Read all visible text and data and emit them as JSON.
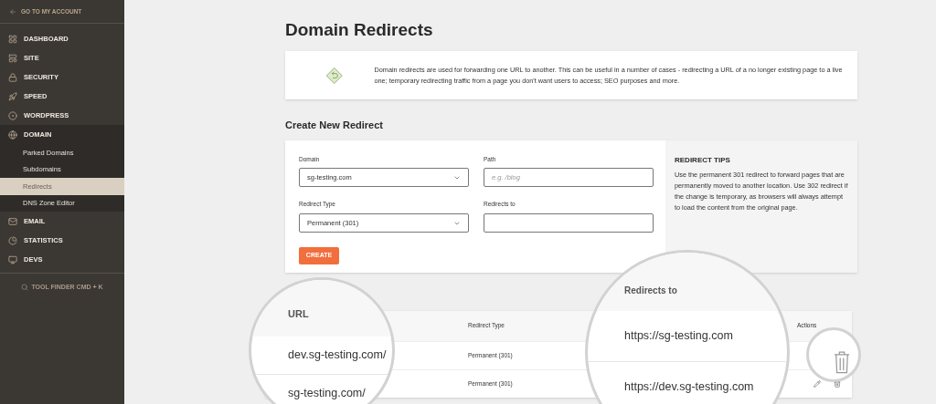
{
  "sidebar": {
    "back_link": "GO TO MY ACCOUNT",
    "items": [
      {
        "label": "DASHBOARD",
        "expanded": false
      },
      {
        "label": "SITE",
        "expanded": false
      },
      {
        "label": "SECURITY",
        "expanded": false
      },
      {
        "label": "SPEED",
        "expanded": false
      },
      {
        "label": "WORDPRESS",
        "expanded": false
      },
      {
        "label": "DOMAIN",
        "expanded": true,
        "children": [
          {
            "label": "Parked Domains",
            "selected": false
          },
          {
            "label": "Subdomains",
            "selected": false
          },
          {
            "label": "Redirects",
            "selected": true
          },
          {
            "label": "DNS Zone Editor",
            "selected": false
          }
        ]
      },
      {
        "label": "EMAIL",
        "expanded": false
      },
      {
        "label": "STATISTICS",
        "expanded": false
      },
      {
        "label": "DEVS",
        "expanded": false
      }
    ],
    "tool_finder": "TOOL FINDER CMD + K"
  },
  "page": {
    "title": "Domain Redirects",
    "intro": "Domain redirects are used for forwarding one URL to another. This can be useful in a number of cases - redirecting a URL of a no longer existing page to a live one; temporary redirecting traffic from a page you don't want users to access; SEO purposes and more.",
    "form": {
      "heading": "Create New Redirect",
      "fields": [
        {
          "label": "Domain",
          "kind": "select",
          "value": "sg-testing.com"
        },
        {
          "label": "Path",
          "kind": "text",
          "placeholder": "e.g. /blog"
        },
        {
          "label": "Redirect Type",
          "kind": "select",
          "value": "Permanent (301)"
        },
        {
          "label": "Redirects to",
          "kind": "text"
        }
      ],
      "button": "CREATE",
      "tips_title": "REDIRECT TIPS",
      "tips_text": "Use the permanent 301 redirect to forward pages that are permanently moved to another location. Use 302 redirect if the change is temporary, as browsers will always attempt to load the content from the original page."
    },
    "table": {
      "columns": [
        "URL",
        "Redirect Type",
        "Redirects to",
        "Actions"
      ],
      "rows": [
        {
          "url": "dev.sg-testing.com/",
          "type": "Permanent (301)",
          "target": "https://sg-testing.com"
        },
        {
          "url": "sg-testing.com/",
          "type": "Permanent (301)",
          "target": "https://dev.sg-testing.com"
        }
      ]
    }
  }
}
